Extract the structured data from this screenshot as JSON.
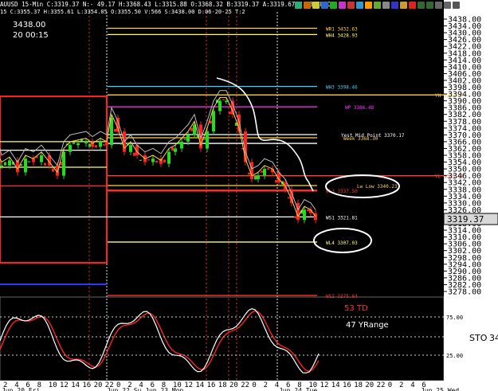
{
  "header": {
    "info": "AUUSD 15-Min C:3319.37 N:- 49.17 H:3368.43 L:3315.88 O:3368.32 B:3319.37 A:3319.67 V:43.4K OI:0",
    "info2": "15 C:3355.37 H:3355.61 L:3354.05 O:3355.50 V:566 S:3438.00 D:06-20-25 T:2"
  },
  "cursor": {
    "price": "3438.00",
    "time": "20 00:15"
  },
  "toolbar": {
    "icons": [
      "bar-chart-icon",
      "zoom-icon",
      "bell-icon",
      "drawing-icon",
      "check-icon",
      "fib-icon",
      "line-icon",
      "ray-icon",
      "arrow-icon",
      "channel-icon",
      "grid-icon",
      "text-icon",
      "erase-icon",
      "close-icon",
      "arrow-left-icon",
      "arrow-right-icon",
      "zoom-out-icon",
      "zoom-in-icon",
      "print-icon"
    ]
  },
  "price_axis": {
    "labels": [
      "3438.00",
      "3434.00",
      "3430.00",
      "3426.00",
      "3422.00",
      "3418.00",
      "3414.00",
      "3410.00",
      "3406.00",
      "3402.00",
      "3398.00",
      "3394.00",
      "3390.00",
      "3386.00",
      "3382.00",
      "3378.00",
      "3374.00",
      "3370.00",
      "3366.00",
      "3362.00",
      "3358.00",
      "3354.00",
      "3350.00",
      "3346.00",
      "3342.00",
      "3338.00",
      "3334.00",
      "3330.00",
      "3326.00",
      "3322.00",
      "3318.00",
      "3314.00",
      "3310.00",
      "3306.00",
      "3302.00",
      "3298.00",
      "3294.00",
      "3290.00",
      "3286.00",
      "3282.00",
      "3278.00"
    ],
    "last_price": "3319.37"
  },
  "time_axis": {
    "hours": [
      "2",
      "4",
      "6",
      "8",
      "10",
      "12",
      "14",
      "16",
      "20",
      "22",
      "0",
      "2",
      "4",
      "6",
      "8",
      "10",
      "12",
      "14",
      "16",
      "18",
      "20",
      "22",
      "0",
      "2",
      "4",
      "6",
      "8",
      "10",
      "12",
      "14",
      "16",
      "18",
      "20",
      "22",
      "0",
      "2",
      "4",
      "6"
    ],
    "days": [
      "Jun 20 Fri",
      "Jun 22 Su Jun 23 Mon",
      "Jun 24 Tue",
      "Jun 25 Wed"
    ]
  },
  "levels": [
    {
      "label": "WR1 3432.63",
      "color": "#ffd24a",
      "price": 3432.63
    },
    {
      "label": "WH4 3428.93",
      "color": "#ffff66",
      "price": 3428.93
    },
    {
      "label": "WH3 3398.46",
      "color": "#33d6ff",
      "price": 3398.46
    },
    {
      "label": "YH 3393.47",
      "color": "#ffd24a",
      "price": 3393.47
    },
    {
      "label": "WP 3386.48",
      "color": "#ff33ff",
      "price": 3386.48
    },
    {
      "label": "Yest Mid Point 3370.17",
      "color": "#ffffff",
      "price": 3370.17
    },
    {
      "label": "Week 3368.30",
      "color": "#ffd24a",
      "price": 3368.3
    },
    {
      "label": "YL 3345.98",
      "color": "#ff4040",
      "price": 3345.98
    },
    {
      "label": "Lw Low 3340.23",
      "color": "#ffd24a",
      "price": 3340.23
    },
    {
      "label": "WL3 3337.50",
      "color": "#ff3333",
      "price": 3337.5
    },
    {
      "label": "WS1 3321.81",
      "color": "#ffffff",
      "price": 3321.81
    },
    {
      "label": "WL4 3307.03",
      "color": "#ffff66",
      "price": 3307.03
    },
    {
      "label": "WS2 3275.64",
      "color": "#ff3333",
      "price": 3275.64
    }
  ],
  "indicator": {
    "name": "STO",
    "value": "34",
    "td_label": "53 TD",
    "range_label": "47 YRange",
    "labels": [
      "75.00",
      "50.00",
      "25.00"
    ]
  },
  "colors": {
    "bull": "#22dd22",
    "bear": "#ff2222",
    "axis_bg": "#ffffff",
    "last_bg": "#ff3333"
  }
}
